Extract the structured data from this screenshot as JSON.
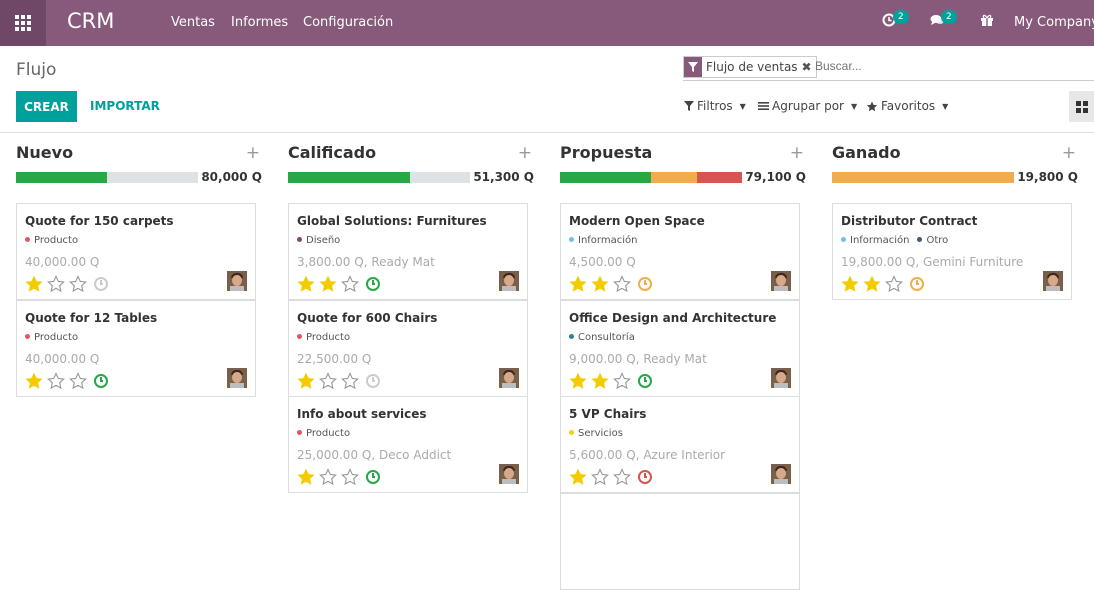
{
  "app": {
    "name": "CRM",
    "menu": [
      "Ventas",
      "Informes",
      "Configuración"
    ],
    "activity_count": "2",
    "message_count": "2",
    "company": "My Company ("
  },
  "page": {
    "title": "Flujo",
    "facet": "Flujo de ventas",
    "search_placeholder": "Buscar...",
    "create": "CREAR",
    "import": "IMPORTAR",
    "filters": "Filtros",
    "group_by": "Agrupar por",
    "favorites": "Favoritos"
  },
  "colors": {
    "accent": "#875a7b",
    "primary": "#00a09d",
    "won": "#28a745",
    "planned": "#f0ad4e",
    "overdue": "#d9534f",
    "star": "#f3cc00"
  },
  "columns": [
    {
      "name": "Nuevo",
      "total": "80,000",
      "currency": "Q",
      "progress": [
        {
          "status": "planned",
          "fraction": 0.5
        }
      ],
      "cards": [
        {
          "name": "Quote for 150 carpets",
          "tags": [
            {
              "name": "Producto",
              "color": "#e0585f"
            }
          ],
          "amount": "40,000.00 Q",
          "stars": 1,
          "activity": "none"
        },
        {
          "name": "Quote for 12 Tables",
          "tags": [
            {
              "name": "Producto",
              "color": "#e0585f"
            }
          ],
          "amount": "40,000.00 Q",
          "stars": 1,
          "activity": "planned"
        }
      ]
    },
    {
      "name": "Calificado",
      "total": "51,300",
      "currency": "Q",
      "progress": [
        {
          "status": "planned",
          "fraction": 0.67
        }
      ],
      "cards": [
        {
          "name": "Global Solutions: Furnitures",
          "tags": [
            {
              "name": "Diseño",
              "color": "#7c4a6a"
            }
          ],
          "amount": "3,800.00 Q, Ready Mat",
          "stars": 2,
          "activity": "planned"
        },
        {
          "name": "Quote for 600 Chairs",
          "tags": [
            {
              "name": "Producto",
              "color": "#e0585f"
            }
          ],
          "amount": "22,500.00 Q",
          "stars": 1,
          "activity": "none"
        },
        {
          "name": "Info about services",
          "tags": [
            {
              "name": "Producto",
              "color": "#e0585f"
            }
          ],
          "amount": "25,000.00 Q, Deco Addict",
          "stars": 1,
          "activity": "planned"
        }
      ]
    },
    {
      "name": "Propuesta",
      "total": "79,100",
      "currency": "Q",
      "progress": [
        {
          "status": "planned",
          "fraction": 0.5
        },
        {
          "status": "today",
          "fraction": 0.25
        },
        {
          "status": "overdue",
          "fraction": 0.25
        }
      ],
      "cards": [
        {
          "name": "Modern Open Space",
          "tags": [
            {
              "name": "Información",
              "color": "#6cc1ed"
            }
          ],
          "amount": "4,500.00 Q",
          "stars": 2,
          "activity": "today"
        },
        {
          "name": "Office Design and Architecture",
          "tags": [
            {
              "name": "Consultoría",
              "color": "#2c8397"
            }
          ],
          "amount": "9,000.00 Q, Ready Mat",
          "stars": 2,
          "activity": "planned"
        },
        {
          "name": "5 VP Chairs",
          "tags": [
            {
              "name": "Servicios",
              "color": "#f7cd1f"
            }
          ],
          "amount": "5,600.00 Q, Azure Interior",
          "stars": 1,
          "activity": "overdue"
        }
      ]
    },
    {
      "name": "Ganado",
      "total": "19,800",
      "currency": "Q",
      "progress": [
        {
          "status": "today",
          "fraction": 1.0
        }
      ],
      "cards": [
        {
          "name": "Distributor Contract",
          "tags": [
            {
              "name": "Información",
              "color": "#6cc1ed"
            },
            {
              "name": "Otro",
              "color": "#475577"
            }
          ],
          "amount": "19,800.00 Q, Gemini Furniture",
          "stars": 2,
          "activity": "today"
        }
      ]
    }
  ]
}
